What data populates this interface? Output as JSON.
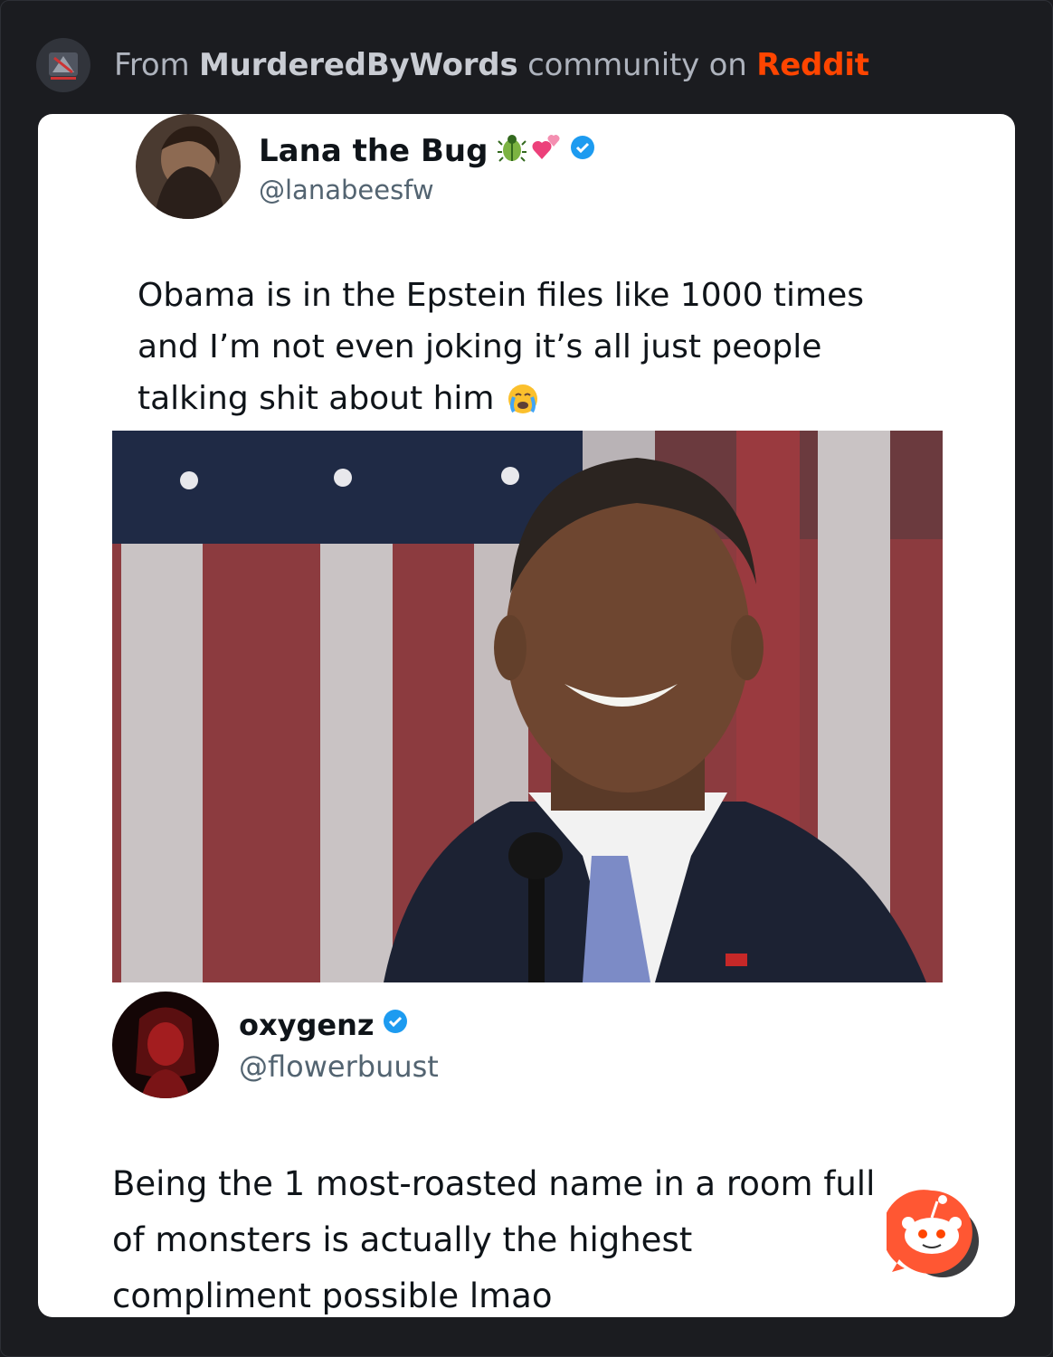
{
  "header": {
    "prefix": "From ",
    "community": "MurderedByWords",
    "middle": " community on ",
    "platform": "Reddit",
    "subreddit_icon": "subreddit-avatar-icon"
  },
  "tweet1": {
    "display_name": "Lana the Bug",
    "emojis": [
      "beetle-icon",
      "two-hearts-icon"
    ],
    "handle": "@lanabeesfw",
    "text_lines": [
      "Obama is in the Epstein files like 1000 times",
      "and I’m not even joking it’s all just people",
      "talking shit about him"
    ],
    "end_emoji": "crying-face-icon",
    "verified": true
  },
  "photo": {
    "name": "obama-photo"
  },
  "tweet2": {
    "display_name": "oxygenz",
    "handle": "@flowerbuust",
    "text_lines": [
      "Being the 1 most-roasted name in a room full",
      "of monsters is actually the highest",
      "compliment possible lmao"
    ],
    "verified": true
  },
  "colors": {
    "background": "#1b1c20",
    "reddit_orange": "#ff4500",
    "verified_blue": "#1d9bf0"
  },
  "fab_icon": "reddit-snoo-icon"
}
